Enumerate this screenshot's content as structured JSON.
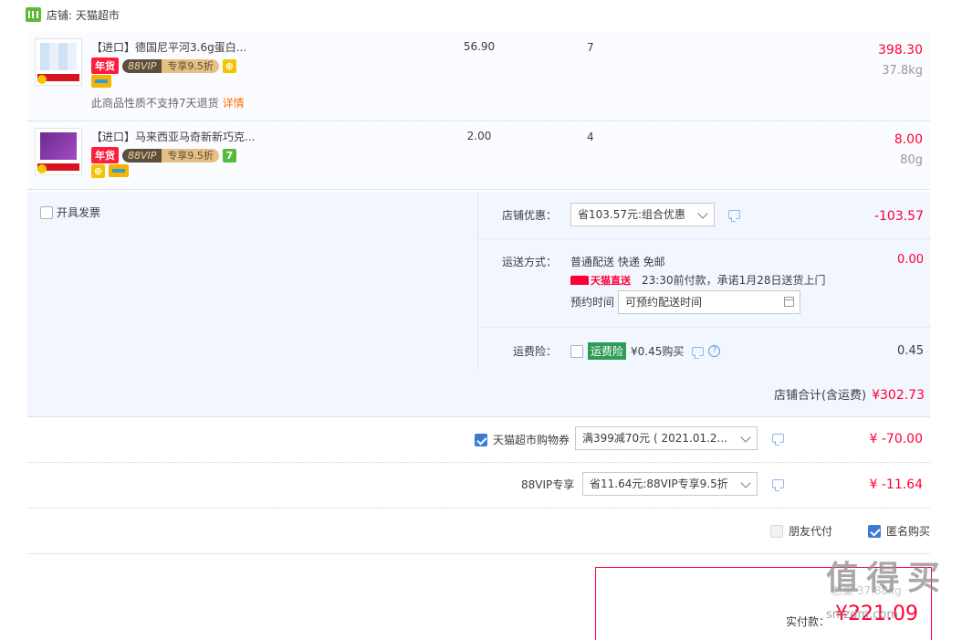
{
  "shop": {
    "label": "店铺: 天猫超市",
    "icon": "tmall-shop-icon"
  },
  "items": [
    {
      "title": "【进口】德国尼平河3.6g蛋白...",
      "tag_nian": "年货",
      "tag_88_left": "88VIP",
      "tag_88_right": "专享9.5折",
      "price": "56.90",
      "qty": "7",
      "subtotal": "398.30",
      "weight": "37.8kg",
      "note": "此商品性质不支持7天退货",
      "note_link": "详情"
    },
    {
      "title": "【进口】马来西亚马奇新新巧克...",
      "tag_nian": "年货",
      "tag_88_left": "88VIP",
      "tag_88_right": "专享9.5折",
      "tag_seven": "7",
      "price": "2.00",
      "qty": "4",
      "subtotal": "8.00",
      "weight": "80g"
    }
  ],
  "invoice_label": "开具发票",
  "shop_discount": {
    "label": "店铺优惠：",
    "select": "省103.57元:组合优惠",
    "amount": "-103.57"
  },
  "delivery": {
    "label": "运送方式：",
    "method": "普通配送 快递 免邮",
    "tmall_direct": "天猫直送",
    "promise": "23:30前付款，承诺1月28日送货上门",
    "appt_label": "预约时间",
    "appt_input": "可预约配送时间",
    "amount": "0.00"
  },
  "insurance": {
    "label": "运费险：",
    "tag": "运费险",
    "price": "¥0.45购买",
    "amount": "0.45"
  },
  "shop_total": {
    "label": "店铺合计(含运费)",
    "value": "¥302.73"
  },
  "coupon": {
    "label": "天猫超市购物券",
    "select": "满399减70元 ( 2021.01.2...",
    "amount": "¥ -70.00"
  },
  "vip": {
    "label": "88VIP专享",
    "select": "省11.64元:88VIP专享9.5折",
    "amount": "¥ -11.64"
  },
  "friend_pay": "朋友代付",
  "anonymous": "匿名购买",
  "total": {
    "faded": "总重 37.88kg",
    "label": "实付款：",
    "value": "¥221.09"
  },
  "watermark": {
    "main": "值 得 买",
    "sub": "smzdm.com"
  }
}
